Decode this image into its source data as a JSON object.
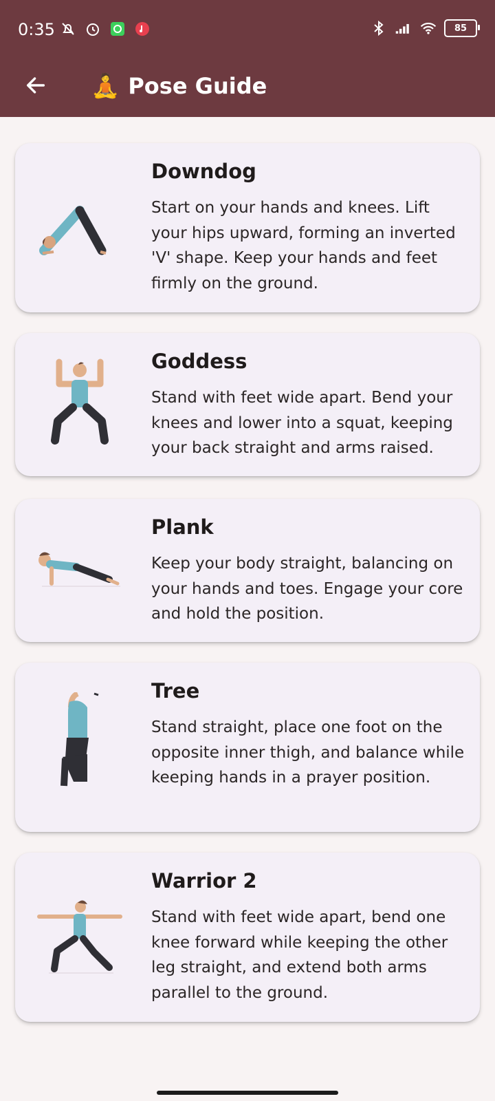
{
  "status_bar": {
    "time": "0:35",
    "battery": "85"
  },
  "app_bar": {
    "title_emoji": "🧘",
    "title": "Pose Guide",
    "back_icon": "arrow-left-icon",
    "header_color": "#6d3a40"
  },
  "poses": [
    {
      "name": "Downdog",
      "description": "Start on your hands and knees. Lift your hips upward, forming an inverted 'V' shape. Keep your hands and feet firmly on the ground.",
      "icon": "downdog-pose-illustration"
    },
    {
      "name": "Goddess",
      "description": "Stand with feet wide apart. Bend your knees and lower into a squat, keeping your back straight and arms raised.",
      "icon": "goddess-pose-illustration"
    },
    {
      "name": "Plank",
      "description": "Keep your body straight, balancing on your hands and toes. Engage your core and hold the position.",
      "icon": "plank-pose-illustration"
    },
    {
      "name": "Tree",
      "description": "Stand straight, place one foot on the opposite inner thigh, and balance while keeping hands in a prayer position.",
      "icon": "tree-pose-illustration"
    },
    {
      "name": "Warrior 2",
      "description": "Stand with feet wide apart, bend one knee forward while keeping the other leg straight, and extend both arms parallel to the ground.",
      "icon": "warrior2-pose-illustration"
    }
  ]
}
